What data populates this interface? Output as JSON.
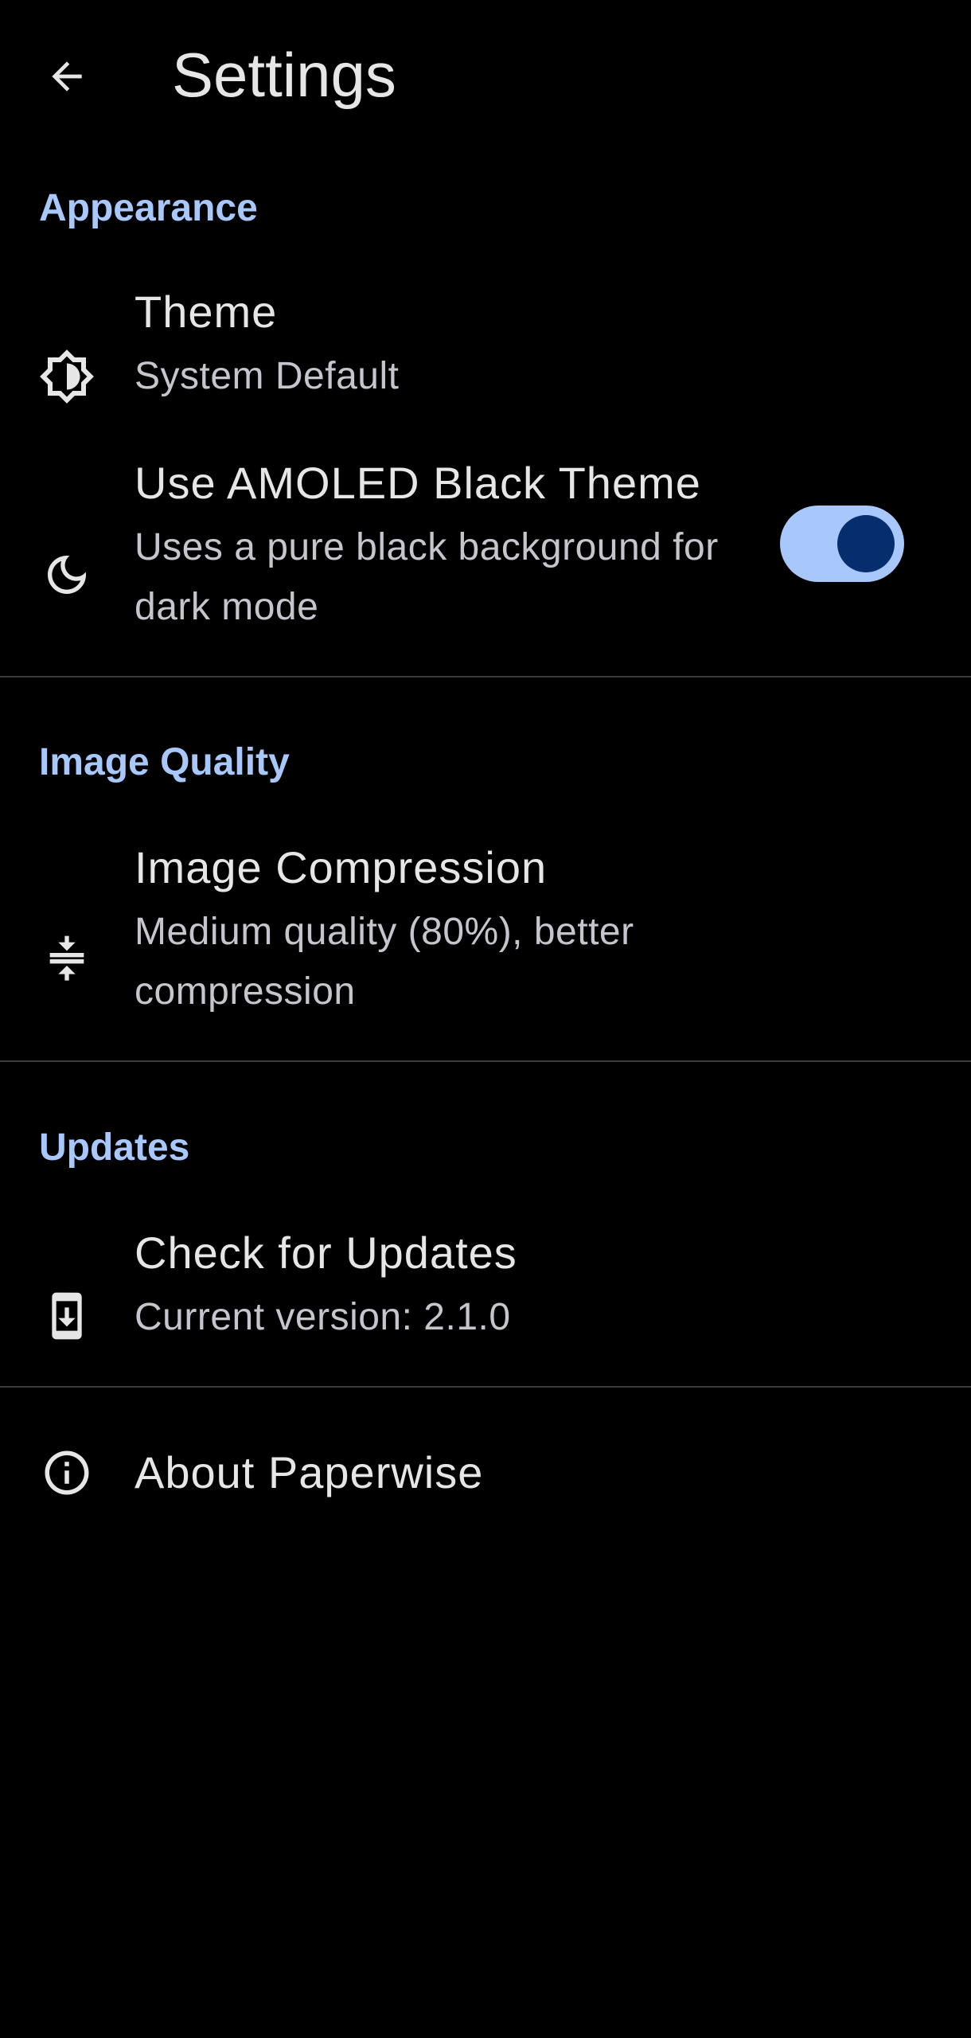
{
  "app_bar": {
    "title": "Settings",
    "back_icon": "arrow-back-icon"
  },
  "sections": {
    "appearance": {
      "header": "Appearance",
      "theme": {
        "icon": "brightness-auto-icon",
        "title": "Theme",
        "subtitle": "System Default"
      },
      "amoled": {
        "icon": "moon-icon",
        "title": "Use AMOLED Black Theme",
        "subtitle": "Uses a pure black background for dark mode",
        "enabled": true
      }
    },
    "image_quality": {
      "header": "Image Quality",
      "compression": {
        "icon": "compress-icon",
        "title": "Image Compression",
        "subtitle": "Medium quality (80%), better compression"
      }
    },
    "updates": {
      "header": "Updates",
      "check": {
        "icon": "system-update-icon",
        "title": "Check for Updates",
        "subtitle": "Current version: 2.1.0"
      }
    },
    "about": {
      "icon": "info-icon",
      "title": "About Paperwise"
    }
  },
  "colors": {
    "background": "#000000",
    "accent": "#a8c7fa",
    "toggle_thumb": "#062e6f",
    "text_primary": "#e6e6e6",
    "text_secondary": "#c5c6cd",
    "divider": "#3b3b3f"
  }
}
